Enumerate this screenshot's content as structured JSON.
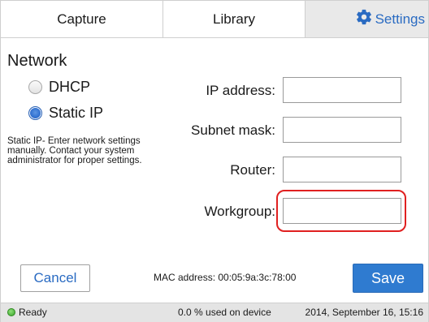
{
  "tabs": [
    {
      "label": "Capture"
    },
    {
      "label": "Library"
    },
    {
      "label": "Settings",
      "icon": "gear-icon",
      "active": true
    }
  ],
  "section": {
    "title": "Network"
  },
  "mode": {
    "options": [
      {
        "label": "DHCP",
        "checked": false
      },
      {
        "label": "Static IP",
        "checked": true
      }
    ],
    "description": "Static IP- Enter network settings manually. Contact your system administrator for proper settings."
  },
  "fields": [
    {
      "label": "IP address:",
      "value": ""
    },
    {
      "label": "Subnet mask:",
      "value": ""
    },
    {
      "label": "Router:",
      "value": ""
    },
    {
      "label": "Workgroup:",
      "value": "",
      "highlighted": true
    }
  ],
  "footer": {
    "cancel_label": "Cancel",
    "mac_text": "MAC address: 00:05:9a:3c:78:00",
    "save_label": "Save"
  },
  "status": {
    "ready": "Ready",
    "usage": "0.0 % used on device",
    "datetime": "2014, September 16, 15:16"
  },
  "colors": {
    "accent": "#2f7bd0",
    "link": "#2a6bc2",
    "highlight": "#e02020",
    "ready_dot": "#3aa52a"
  }
}
